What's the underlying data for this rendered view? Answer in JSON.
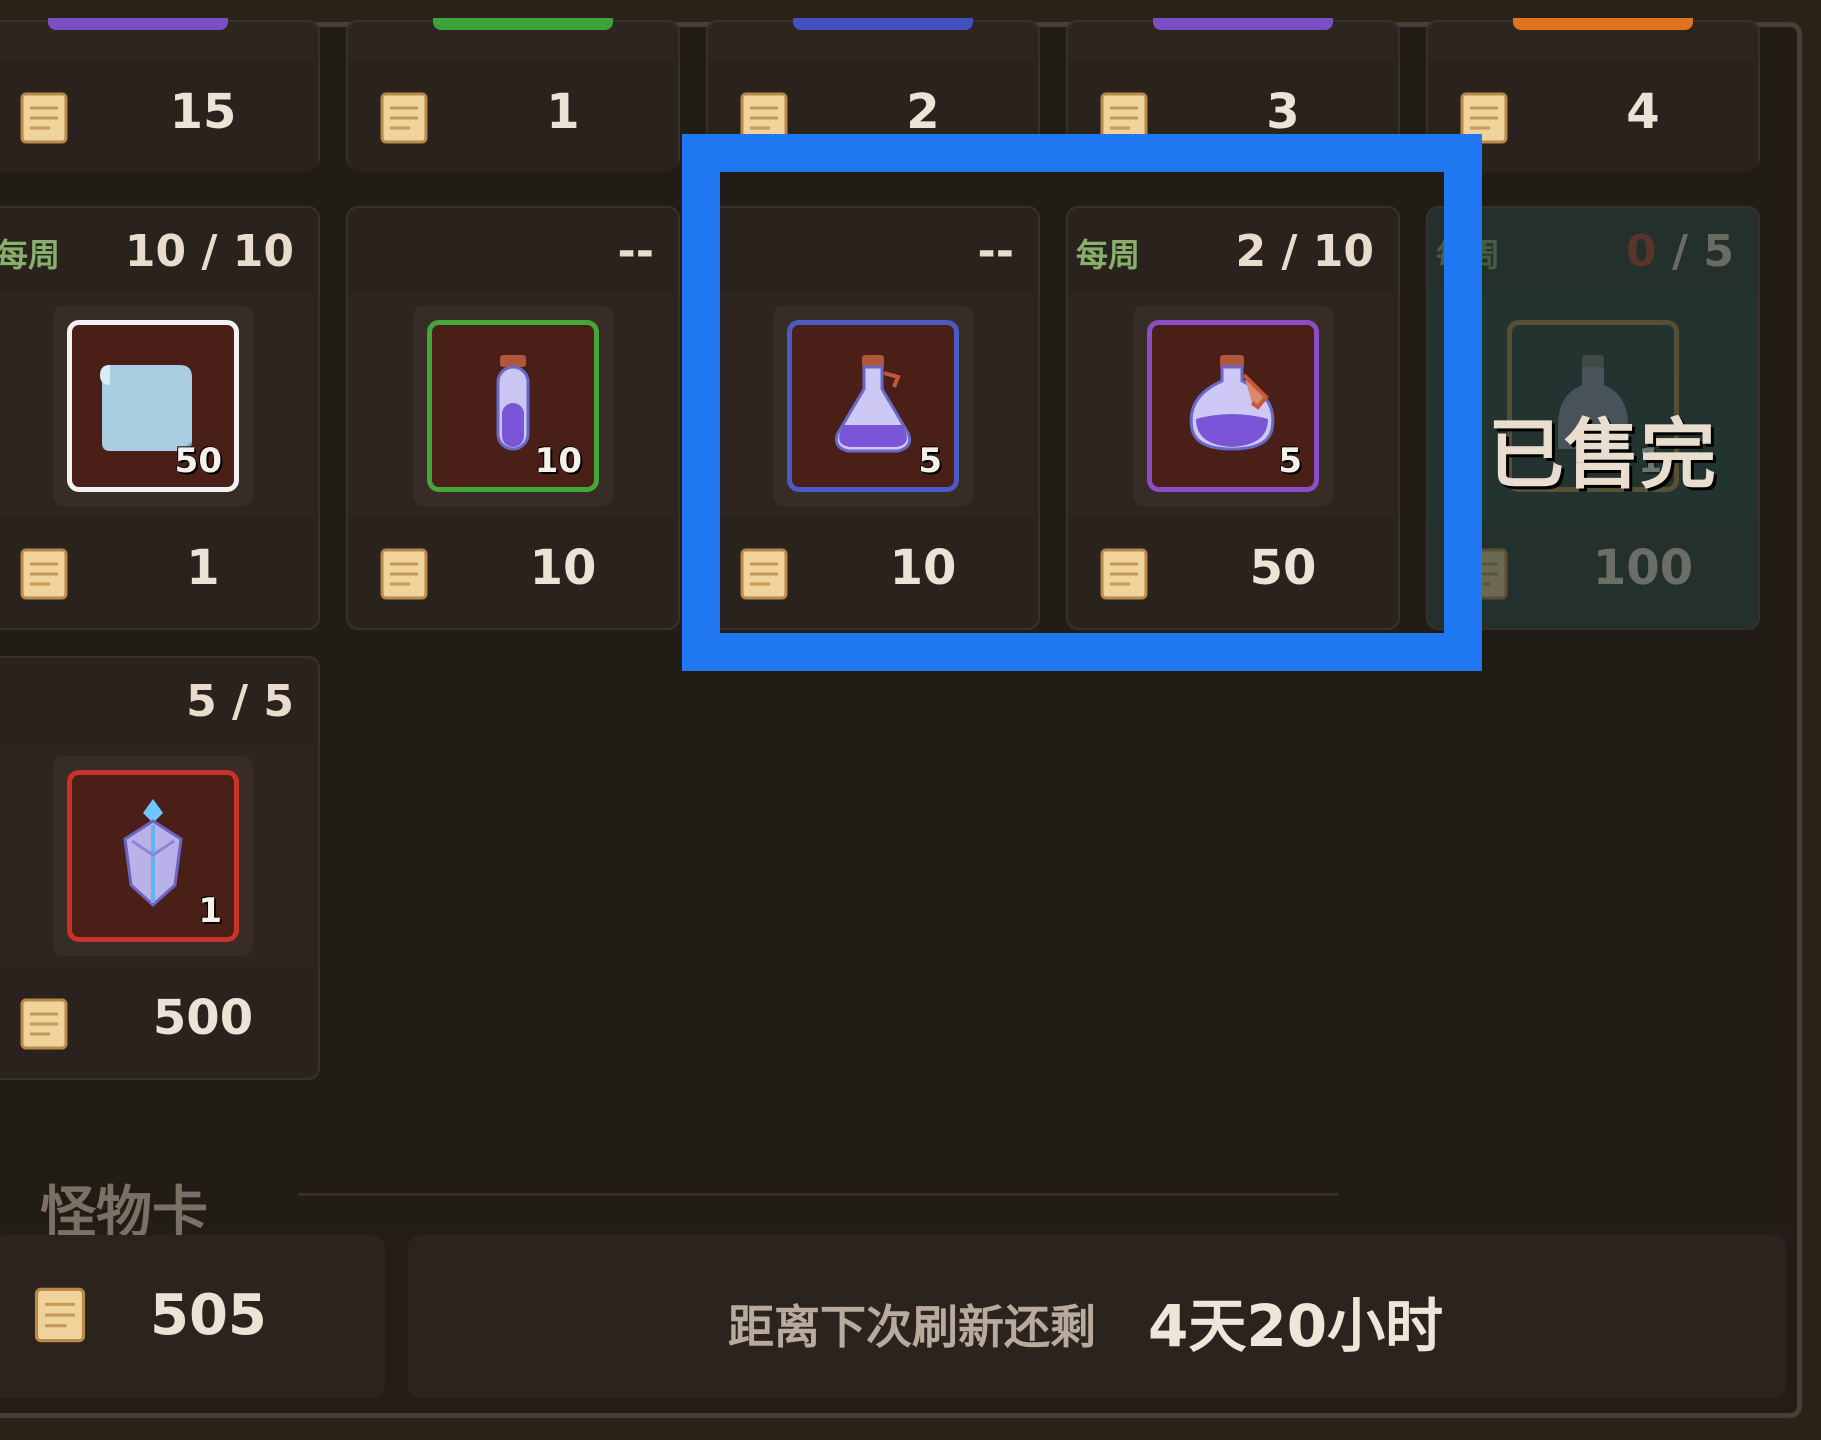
{
  "top_row_prices": [
    "15",
    "1",
    "2",
    "3",
    "4"
  ],
  "items": [
    {
      "tag": "每周",
      "limit": "10 / 10",
      "qty": "50",
      "price": "1",
      "frame_color": "#f2f2f2",
      "icon": "scroll-icon"
    },
    {
      "tag": "",
      "limit": "--",
      "qty": "10",
      "price": "10",
      "frame_color": "#46a63c",
      "icon": "test-tube-potion-icon"
    },
    {
      "tag": "",
      "limit": "--",
      "qty": "5",
      "price": "10",
      "frame_color": "#4b5ac4",
      "icon": "small-flask-potion-icon"
    },
    {
      "tag": "每周",
      "limit": "2 / 10",
      "qty": "5",
      "price": "50",
      "frame_color": "#8a4fc8",
      "icon": "large-flask-potion-icon"
    },
    {
      "tag": "每周",
      "limit_current": "0",
      "limit_max": "/ 5",
      "qty": "1",
      "price": "100",
      "frame_color": "#b8843e",
      "icon": "bottle-icon",
      "sold_out": "已售完"
    },
    {
      "tag": "",
      "limit": "5 / 5",
      "qty": "1",
      "price": "500",
      "frame_color": "#c8322a",
      "icon": "crystal-icon"
    }
  ],
  "section_title": "怪物卡",
  "footer": {
    "wallet": "505",
    "refresh_label": "距离下次刷新还剩",
    "refresh_time": "4天20小时"
  },
  "colors": {
    "highlight": "#1f78f2",
    "weekly_tag": "#86b06c",
    "sold_limit": "#c0392b"
  }
}
